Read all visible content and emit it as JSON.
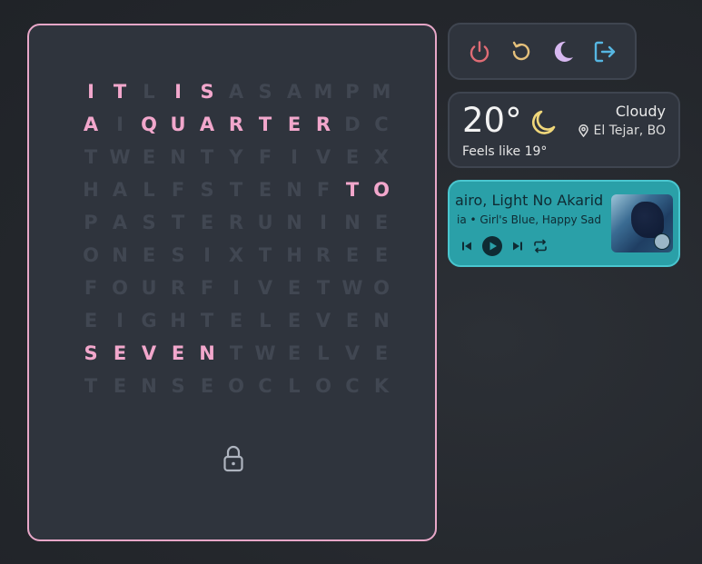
{
  "clock": {
    "rows": [
      [
        [
          "I",
          1
        ],
        [
          "T",
          1
        ],
        [
          "L",
          0
        ],
        [
          "I",
          1
        ],
        [
          "S",
          1
        ],
        [
          "A",
          0
        ],
        [
          "S",
          0
        ],
        [
          "A",
          0
        ],
        [
          "M",
          0
        ],
        [
          "P",
          0
        ],
        [
          "M",
          0
        ]
      ],
      [
        [
          "A",
          1
        ],
        [
          "I",
          0
        ],
        [
          "Q",
          1
        ],
        [
          "U",
          1
        ],
        [
          "A",
          1
        ],
        [
          "R",
          1
        ],
        [
          "T",
          1
        ],
        [
          "E",
          1
        ],
        [
          "R",
          1
        ],
        [
          "D",
          0
        ],
        [
          "C",
          0
        ]
      ],
      [
        [
          "T",
          0
        ],
        [
          "W",
          0
        ],
        [
          "E",
          0
        ],
        [
          "N",
          0
        ],
        [
          "T",
          0
        ],
        [
          "Y",
          0
        ],
        [
          "F",
          0
        ],
        [
          "I",
          0
        ],
        [
          "V",
          0
        ],
        [
          "E",
          0
        ],
        [
          "X",
          0
        ]
      ],
      [
        [
          "H",
          0
        ],
        [
          "A",
          0
        ],
        [
          "L",
          0
        ],
        [
          "F",
          0
        ],
        [
          "S",
          0
        ],
        [
          "T",
          0
        ],
        [
          "E",
          0
        ],
        [
          "N",
          0
        ],
        [
          "F",
          0
        ],
        [
          "T",
          1
        ],
        [
          "O",
          1
        ]
      ],
      [
        [
          "P",
          0
        ],
        [
          "A",
          0
        ],
        [
          "S",
          0
        ],
        [
          "T",
          0
        ],
        [
          "E",
          0
        ],
        [
          "R",
          0
        ],
        [
          "U",
          0
        ],
        [
          "N",
          0
        ],
        [
          "I",
          0
        ],
        [
          "N",
          0
        ],
        [
          "E",
          0
        ]
      ],
      [
        [
          "O",
          0
        ],
        [
          "N",
          0
        ],
        [
          "E",
          0
        ],
        [
          "S",
          0
        ],
        [
          "I",
          0
        ],
        [
          "X",
          0
        ],
        [
          "T",
          0
        ],
        [
          "H",
          0
        ],
        [
          "R",
          0
        ],
        [
          "E",
          0
        ],
        [
          "E",
          0
        ]
      ],
      [
        [
          "F",
          0
        ],
        [
          "O",
          0
        ],
        [
          "U",
          0
        ],
        [
          "R",
          0
        ],
        [
          "F",
          0
        ],
        [
          "I",
          0
        ],
        [
          "V",
          0
        ],
        [
          "E",
          0
        ],
        [
          "T",
          0
        ],
        [
          "W",
          0
        ],
        [
          "O",
          0
        ]
      ],
      [
        [
          "E",
          0
        ],
        [
          "I",
          0
        ],
        [
          "G",
          0
        ],
        [
          "H",
          0
        ],
        [
          "T",
          0
        ],
        [
          "E",
          0
        ],
        [
          "L",
          0
        ],
        [
          "E",
          0
        ],
        [
          "V",
          0
        ],
        [
          "E",
          0
        ],
        [
          "N",
          0
        ]
      ],
      [
        [
          "S",
          1
        ],
        [
          "E",
          1
        ],
        [
          "V",
          1
        ],
        [
          "E",
          1
        ],
        [
          "N",
          1
        ],
        [
          "T",
          0
        ],
        [
          "W",
          0
        ],
        [
          "E",
          0
        ],
        [
          "L",
          0
        ],
        [
          "V",
          0
        ],
        [
          "E",
          0
        ]
      ],
      [
        [
          "T",
          0
        ],
        [
          "E",
          0
        ],
        [
          "N",
          0
        ],
        [
          "S",
          0
        ],
        [
          "E",
          0
        ],
        [
          "O",
          0
        ],
        [
          "C",
          0
        ],
        [
          "L",
          0
        ],
        [
          "O",
          0
        ],
        [
          "C",
          0
        ],
        [
          "K",
          0
        ]
      ]
    ],
    "lock_icon": "lock-icon",
    "accent_color": "#f2a7cc"
  },
  "power": {
    "buttons": [
      {
        "icon": "power-icon",
        "color": "#e06c75"
      },
      {
        "icon": "restart-icon",
        "color": "#e5c07b"
      },
      {
        "icon": "moon-sleep-icon",
        "color": "#d7b8f0"
      },
      {
        "icon": "logout-icon",
        "color": "#56b6e2"
      }
    ]
  },
  "weather": {
    "temperature": "20°",
    "condition": "Cloudy",
    "location": "El Tejar, BO",
    "feels_like": "Feels like 19°",
    "icon": "moon-night-icon",
    "icon_color": "#f0d77a"
  },
  "music": {
    "title": "airo, Light No Akaridak",
    "artist": "ia • Girl's Blue, Happy Sad",
    "accent_color": "#2aa0a8"
  }
}
